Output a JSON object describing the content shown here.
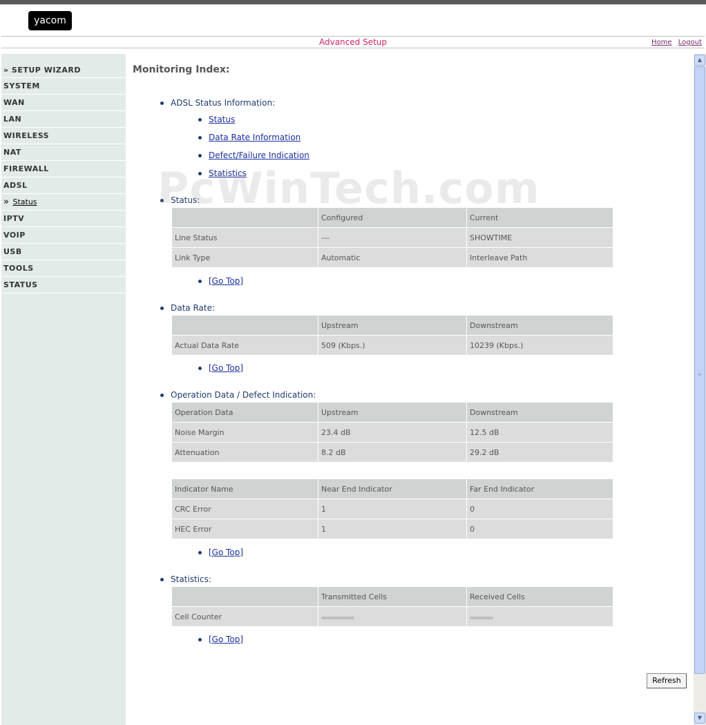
{
  "header": {
    "logo": "yacom",
    "title": "Advanced Setup",
    "links": [
      "Home",
      "Logout"
    ]
  },
  "sidebar": {
    "items": [
      "» SETUP WIZARD",
      "SYSTEM",
      "WAN",
      "LAN",
      "WIRELESS",
      "NAT",
      "FIREWALL",
      "ADSL"
    ],
    "sub_marker": "»",
    "sub_item": "Status",
    "items_after": [
      "IPTV",
      "VOIP",
      "USB",
      "TOOLS",
      "STATUS"
    ]
  },
  "main": {
    "title": "Monitoring Index:",
    "index_label": "ADSL Status Information:",
    "index_links": [
      "Status",
      "Data Rate Information",
      "Defect/Failure Indication",
      "Statistics"
    ],
    "go_top": "[Go Top]",
    "status": {
      "label": "Status:",
      "header": [
        "",
        "Configured",
        "Current"
      ],
      "rows": [
        [
          "Line Status",
          "---",
          "SHOWTIME"
        ],
        [
          "Link Type",
          "Automatic",
          "Interleave Path"
        ]
      ]
    },
    "data_rate": {
      "label": "Data Rate:",
      "header": [
        "",
        "Upstream",
        "Downstream"
      ],
      "rows": [
        [
          "Actual Data Rate",
          "509 (Kbps.)",
          "10239 (Kbps.)"
        ]
      ]
    },
    "operation": {
      "label": "Operation Data / Defect Indication:",
      "header": [
        "Operation Data",
        "Upstream",
        "Downstream"
      ],
      "rows": [
        [
          "Noise Margin",
          "23.4 dB",
          "12.5 dB"
        ],
        [
          "Attenuation",
          "8.2 dB",
          "29.2 dB"
        ]
      ]
    },
    "indicators": {
      "header": [
        "Indicator Name",
        "Near End Indicator",
        "Far End Indicator"
      ],
      "rows": [
        [
          "CRC Error",
          "1",
          "0"
        ],
        [
          "HEC Error",
          "1",
          "0"
        ]
      ]
    },
    "statistics": {
      "label": "Statistics:",
      "header": [
        "",
        "Transmitted Cells",
        "Received Cells"
      ],
      "rows": [
        [
          "Cell Counter",
          "",
          ""
        ]
      ]
    },
    "refresh_button": "Refresh"
  },
  "watermark": "PcWinTech.com",
  "colors": {
    "accent": "#d0256b",
    "sidebar_bg": "#e3ebe9",
    "table_cell": "#dcdcdc",
    "link": "#1a2fa0"
  }
}
